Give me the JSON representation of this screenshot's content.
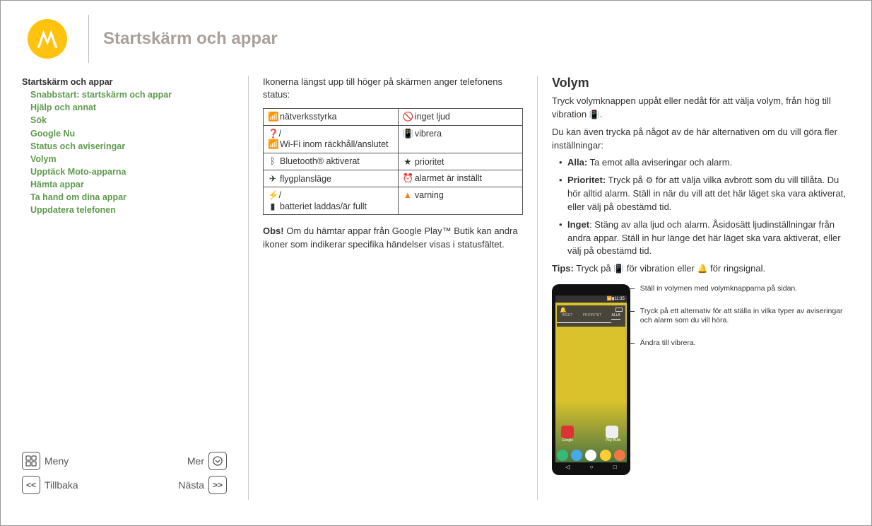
{
  "header": {
    "title": "Startskärm och appar"
  },
  "toc": {
    "heading": "Startskärm och appar",
    "items": [
      "Snabbstart: startskärm och appar",
      "Hjälp och annat",
      "Sök",
      "Google Nu",
      "Status och aviseringar",
      "Volym",
      "Upptäck Moto-apparna",
      "Hämta appar",
      "Ta hand om dina appar",
      "Uppdatera telefonen"
    ]
  },
  "nav": {
    "menu": "Meny",
    "more": "Mer",
    "back": "Tillbaka",
    "next": "Nästa"
  },
  "center": {
    "intro": "Ikonerna längst upp till höger på skärmen anger telefonens status:",
    "table": {
      "rows": [
        {
          "left_icon": "📶",
          "left": "nätverksstyrka",
          "right_icon": "🚫",
          "right": "inget ljud"
        },
        {
          "left_icon": "❓/📶",
          "left": "Wi-Fi inom räckhåll/anslutet",
          "right_icon": "📳",
          "right": "vibrera"
        },
        {
          "left_icon": "ᛒ",
          "left": "Bluetooth® aktiverat",
          "right_icon": "★",
          "right": "prioritet"
        },
        {
          "left_icon": "✈",
          "left": "flygplansläge",
          "right_icon": "⏰",
          "right": "alarmet är inställt"
        },
        {
          "left_icon": "⚡/▮",
          "left": "batteriet laddas/är fullt",
          "right_icon": "▲",
          "right": "varning",
          "right_icon_class": "orange-tri"
        }
      ]
    },
    "note_bold": "Obs!",
    "note": " Om du hämtar appar från Google Play™ Butik kan andra ikoner som indikerar specifika händelser visas i statusfältet."
  },
  "right": {
    "title": "Volym",
    "p1a": "Tryck volymknappen uppåt eller nedåt för att välja volym, från hög till vibration ",
    "p1_icon": "📳",
    "p1b": ".",
    "p2": "Du kan även trycka på något av de här alternativen om du vill göra fler inställningar:",
    "bullets": {
      "b1_label": "Alla:",
      "b1": " Ta emot alla aviseringar och alarm.",
      "b2_label": "Prioritet:",
      "b2a": " Tryck på ",
      "b2_icon": "⚙",
      "b2b": " för att välja vilka avbrott som du vill tillåta. Du hör alltid alarm. Ställ in när du vill att det här läget ska vara aktiverat, eller välj på obestämd tid.",
      "b3_label": "Inget",
      "b3": ": Stäng av alla ljud och alarm. Åsidosätt ljudinställningar från andra appar. Ställ in hur länge det här läget ska vara aktiverat, eller välj på obestämd tid."
    },
    "tips_label": "Tips:",
    "tips_a": " Tryck på ",
    "tips_icon1": "📳",
    "tips_b": " för vibration eller ",
    "tips_icon2": "🔔",
    "tips_c": " för ringsignal.",
    "phone": {
      "time": "11:35",
      "tabs": {
        "none": "INGET",
        "priority": "PRIORITET",
        "all": "ALLA"
      },
      "apps": {
        "left": "Google",
        "right": "Play Butik"
      }
    },
    "callouts": {
      "c1": "Ställ in volymen med volymknapparna på sidan.",
      "c2": "Tryck på ett alternativ för att ställa in vilka typer av aviseringar och alarm som du vill höra.",
      "c3": "Ändra till vibrera."
    }
  }
}
